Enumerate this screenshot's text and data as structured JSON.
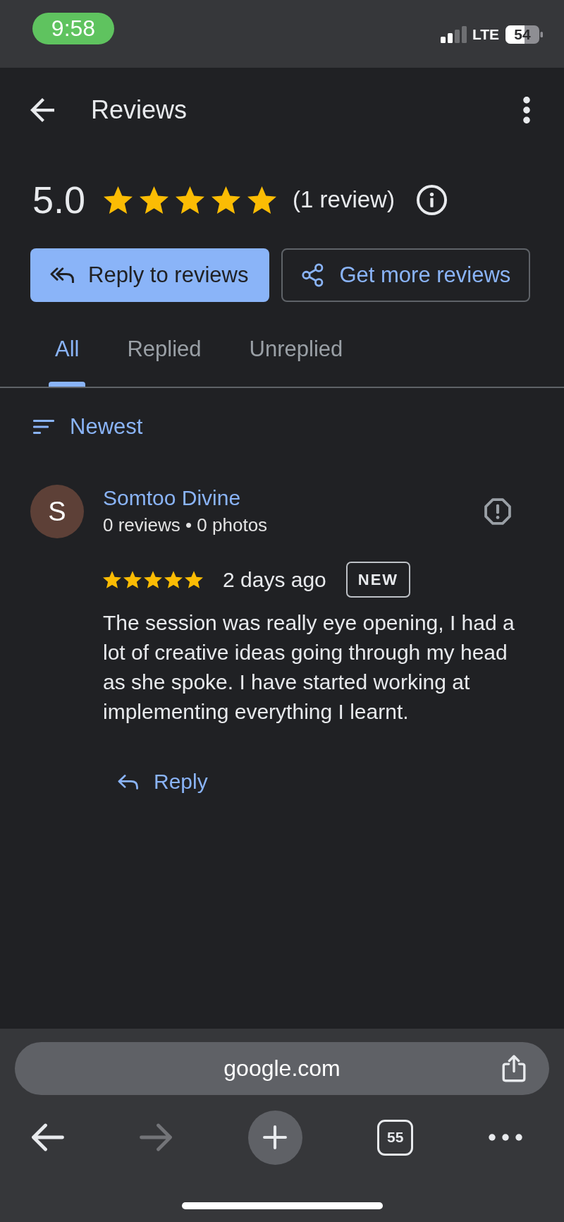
{
  "status_bar": {
    "time": "9:58",
    "network": "LTE",
    "battery": "54"
  },
  "header": {
    "title": "Reviews"
  },
  "summary": {
    "rating": "5.0",
    "stars": 5,
    "count": "(1 review)"
  },
  "actions": [
    {
      "kind": "primary",
      "label": "Reply to reviews"
    },
    {
      "kind": "outlined",
      "label": "Get more reviews"
    }
  ],
  "tabs": [
    {
      "label": "All",
      "selected": true
    },
    {
      "label": "Replied",
      "selected": false
    },
    {
      "label": "Unreplied",
      "selected": false
    }
  ],
  "sort": {
    "label": "Newest"
  },
  "reviews": [
    {
      "avatar": "S",
      "color": "#5d4037",
      "author": "Somtoo Divine",
      "meta": "0 reviews • 0 photos",
      "stars": 5,
      "time": "2 days ago",
      "badge": "NEW",
      "text": "The session was really eye opening, I had a lot of creative ideas going through my head as she spoke. I have started working at implementing everything I learnt.",
      "reply": "Reply"
    }
  ],
  "browser": {
    "url": "google.com",
    "forward_enabled": false,
    "tab_count": "55"
  }
}
